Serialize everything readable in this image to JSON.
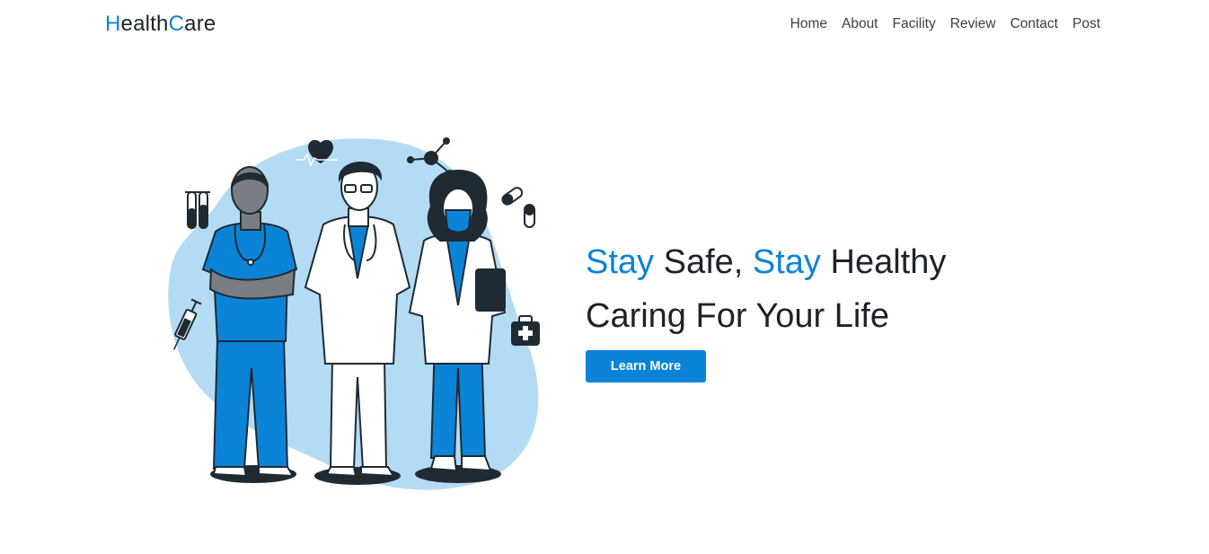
{
  "brand": {
    "first_initial": "H",
    "first_rest": "ealth",
    "second_initial": "C",
    "second_rest": "are"
  },
  "nav": {
    "items": [
      {
        "label": "Home"
      },
      {
        "label": "About"
      },
      {
        "label": "Facility"
      },
      {
        "label": "Review"
      },
      {
        "label": "Contact"
      },
      {
        "label": "Post"
      }
    ]
  },
  "hero": {
    "line1": {
      "word1": "Stay",
      "word2": " Safe, ",
      "word3": "Stay",
      "word4": " Healthy"
    },
    "line2": "Caring For Your Life",
    "button_label": "Learn More"
  },
  "colors": {
    "accent": "#0b84d8",
    "text_dark": "#1d2329",
    "illustration_blob": "#b3dcf4",
    "scrubs_blue": "#0b84d8"
  },
  "icons": [
    "heartbeat-icon",
    "molecule-icon",
    "test-tubes-icon",
    "capsule-icon",
    "syringe-icon",
    "first-aid-kit-icon"
  ]
}
